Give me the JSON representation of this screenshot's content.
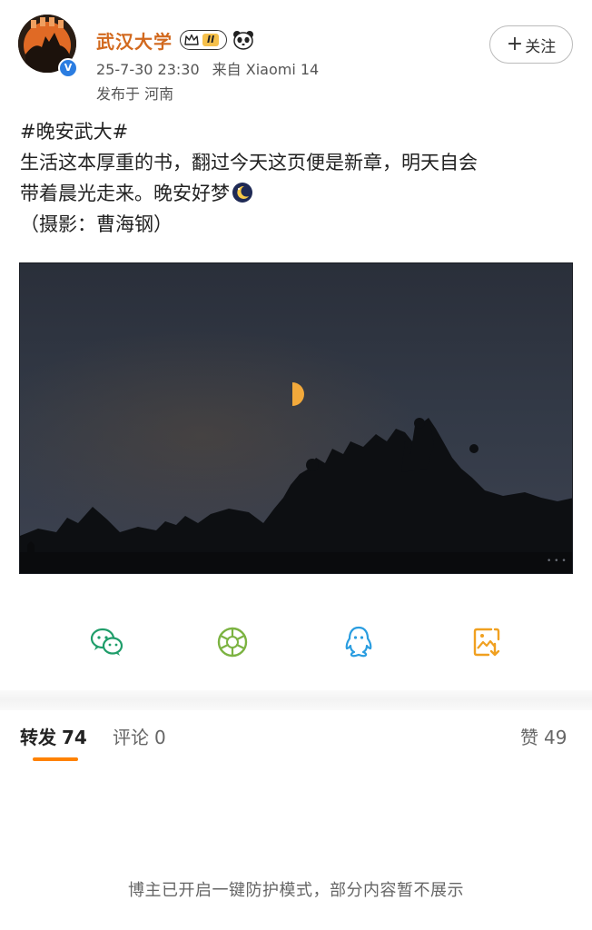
{
  "header": {
    "username": "武汉大学",
    "level_badge": "II",
    "timestamp": "25-7-30 23:30",
    "source": "来自 Xiaomi 14",
    "location": "发布于 河南",
    "follow_label": "关注"
  },
  "post": {
    "hashtag": "#晚安武大#",
    "line1": "生活这本厚重的书，翻过今天这页便是新章，明天自会",
    "line2": "带着晨光走来。晚安好梦",
    "credit": "（摄影：曹海钢）"
  },
  "share": {
    "icons": [
      "wechat-icon",
      "moments-icon",
      "qq-icon",
      "save-image-icon"
    ]
  },
  "tabs": {
    "repost_label": "转发",
    "repost_count": "74",
    "comment_label": "评论",
    "comment_count": "0",
    "like_label": "赞",
    "like_count": "49"
  },
  "notice": "博主已开启一键防护模式，部分内容暂不展示",
  "colors": {
    "username": "#d2691e",
    "tab_underline": "#ff8200",
    "verified": "#2b7de1"
  }
}
